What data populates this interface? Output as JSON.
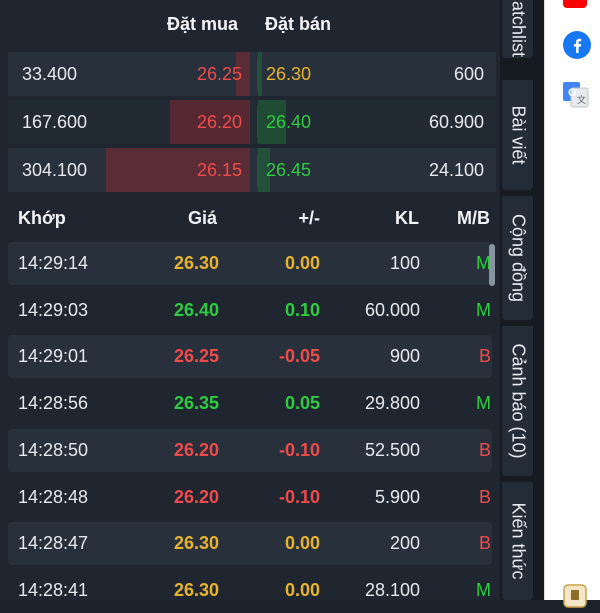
{
  "order_book": {
    "headers": {
      "buy": "Đặt mua",
      "sell": "Đặt bán"
    },
    "rows": [
      {
        "buy_vol": "33.400",
        "buy_price": "26.25",
        "sell_price": "26.30",
        "sell_vol": "600",
        "sell_color": "#e8b32e"
      },
      {
        "buy_vol": "167.600",
        "buy_price": "26.20",
        "sell_price": "26.40",
        "sell_vol": "60.900",
        "sell_color": "#2ecc40"
      },
      {
        "buy_vol": "304.100",
        "buy_price": "26.15",
        "sell_price": "26.45",
        "sell_vol": "24.100",
        "sell_color": "#2ecc40"
      }
    ]
  },
  "trades": {
    "headers": {
      "time": "Khớp",
      "price": "Giá",
      "change": "+/-",
      "volume": "KL",
      "side": "M/B"
    },
    "rows": [
      {
        "time": "14:29:14",
        "price": "26.30",
        "change": "0.00",
        "volume": "100",
        "side": "M",
        "color": "#e8b32e",
        "side_color": "#2ecc40"
      },
      {
        "time": "14:29:03",
        "price": "26.40",
        "change": "0.10",
        "volume": "60.000",
        "side": "M",
        "color": "#2ecc40",
        "side_color": "#2ecc40"
      },
      {
        "time": "14:29:01",
        "price": "26.25",
        "change": "-0.05",
        "volume": "900",
        "side": "B",
        "color": "#ef4b4b",
        "side_color": "#ef4b4b"
      },
      {
        "time": "14:28:56",
        "price": "26.35",
        "change": "0.05",
        "volume": "29.800",
        "side": "M",
        "color": "#2ecc40",
        "side_color": "#2ecc40"
      },
      {
        "time": "14:28:50",
        "price": "26.20",
        "change": "-0.10",
        "volume": "52.500",
        "side": "B",
        "color": "#ef4b4b",
        "side_color": "#ef4b4b"
      },
      {
        "time": "14:28:48",
        "price": "26.20",
        "change": "-0.10",
        "volume": "5.900",
        "side": "B",
        "color": "#ef4b4b",
        "side_color": "#ef4b4b"
      },
      {
        "time": "14:28:47",
        "price": "26.30",
        "change": "0.00",
        "volume": "200",
        "side": "B",
        "color": "#e8b32e",
        "side_color": "#ef4b4b"
      },
      {
        "time": "14:28:41",
        "price": "26.30",
        "change": "0.00",
        "volume": "28.100",
        "side": "M",
        "color": "#e8b32e",
        "side_color": "#2ecc40"
      }
    ]
  },
  "side_tabs": [
    {
      "label": "atchlist"
    },
    {
      "label": "Bài viết"
    },
    {
      "label": "Cộng đồng"
    },
    {
      "label": "Cảnh báo (10)"
    },
    {
      "label": "Kiến thức"
    }
  ],
  "rail_icons": [
    "youtube-icon",
    "facebook-icon",
    "google-translate-icon",
    "extension-icon"
  ],
  "colors": {
    "up": "#2ecc40",
    "down": "#ef4b4b",
    "ref": "#e8b32e",
    "facebook": "#1877f2",
    "youtube": "#ff0000"
  }
}
